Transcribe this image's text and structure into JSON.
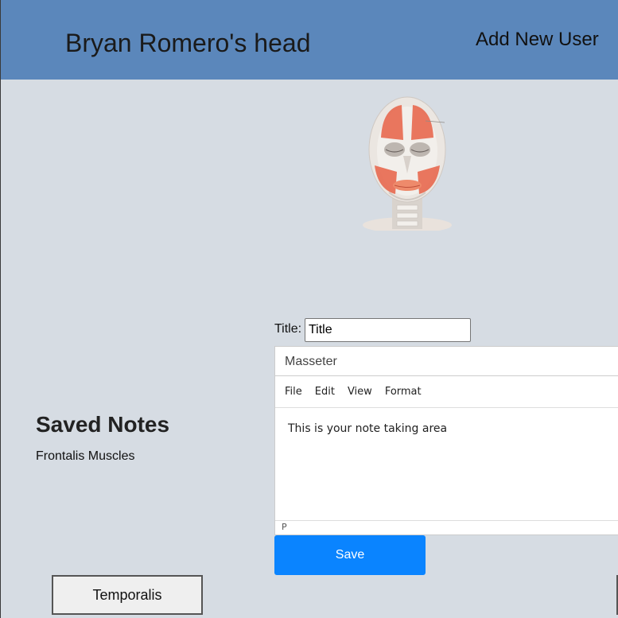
{
  "header": {
    "title": "Bryan Romero's head",
    "add_user_label": "Add New User",
    "background": "#5b87bb"
  },
  "illustration": {
    "icon": "head-muscles-illustration"
  },
  "saved_notes": {
    "title": "Saved Notes",
    "items": [
      "Frontalis Muscles"
    ]
  },
  "note_form": {
    "title_label": "Title:",
    "title_value": "Title",
    "editor_heading": "Masseter",
    "menu": [
      "File",
      "Edit",
      "View",
      "Format"
    ],
    "content": "This is your note taking area",
    "status_path": "P",
    "save_label": "Save",
    "save_color": "#0a84ff"
  },
  "bottom_buttons": {
    "left_label": "Temporalis"
  }
}
